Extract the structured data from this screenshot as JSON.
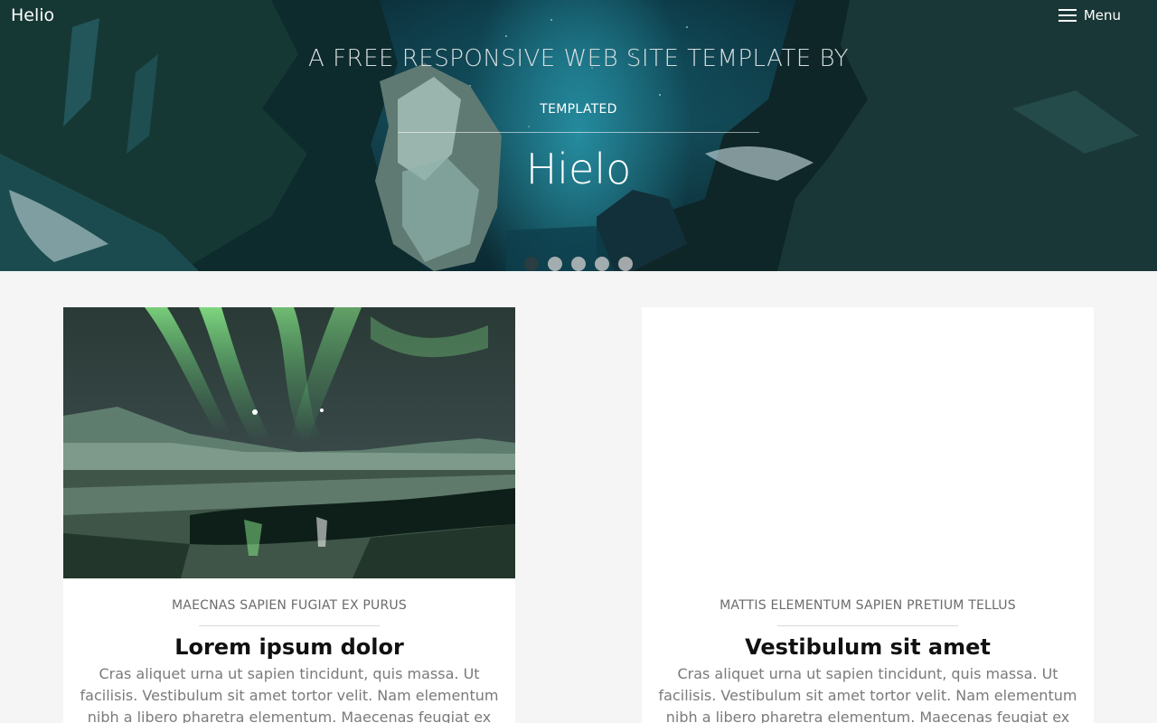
{
  "header": {
    "brand": "Helio",
    "menu_label": "Menu",
    "menu_icon": "hamburger-icon"
  },
  "hero": {
    "subtitle": "A FREE RESPONSIVE WEB SITE TEMPLATE BY",
    "subtitle2": "TEMPLATED",
    "title": "Hielo",
    "slides_count": 5,
    "active_slide": 1
  },
  "cards": [
    {
      "kicker": "MAECNAS SAPIEN FUGIAT EX PURUS",
      "title": "Lorem ipsum dolor",
      "body": "Cras aliquet urna ut sapien tincidunt, quis massa. Ut facilisis. Vestibulum sit amet tortor velit. Nam elementum nibh a libero pharetra elementum. Maecenas feugiat ex purus, quis"
    },
    {
      "kicker": "MATTIS ELEMENTUM SAPIEN PRETIUM TELLUS",
      "title": "Vestibulum sit amet",
      "body": "Cras aliquet urna ut sapien tincidunt, quis massa. Ut facilisis. Vestibulum sit amet tortor velit. Nam elementum nibh a libero pharetra elementum. Maecenas feugiat ex purus, quis"
    }
  ],
  "colors": {
    "page_bg": "#f5f5f5",
    "card_bg": "#ffffff",
    "hero_teal": "#1f7f92",
    "title_text": "#111111",
    "body_text": "#7a7a7a"
  }
}
